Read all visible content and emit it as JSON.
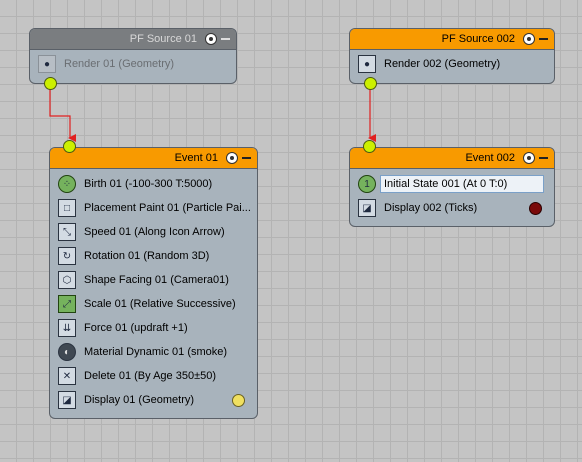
{
  "nodes": {
    "pf_source_01": {
      "title": "PF Source 01",
      "items": [
        "Render 01 (Geometry)"
      ]
    },
    "pf_source_002": {
      "title": "PF Source 002",
      "items": [
        "Render 002 (Geometry)"
      ]
    },
    "event_01": {
      "title": "Event 01",
      "items": [
        "Birth 01 (-100-300 T:5000)",
        "Placement Paint 01 (Particle Pai...",
        "Speed 01 (Along Icon Arrow)",
        "Rotation 01 (Random 3D)",
        "Shape Facing 01 (Camera01)",
        "Scale 01 (Relative Successive)",
        "Force 01 (updraft +1)",
        "Material Dynamic 01 (smoke)",
        "Delete 01 (By Age 350±50)",
        "Display 01 (Geometry)"
      ]
    },
    "event_002": {
      "title": "Event 002",
      "items": [
        "Initial State 001 (At 0 T:0)",
        "Display 002 (Ticks)"
      ]
    }
  },
  "colors": {
    "header_active": "#f89a00",
    "header_inactive": "#7a7d80",
    "port": "#ccf000",
    "wire": "#e02020",
    "display_01_swatch": "#f0e060",
    "display_002_swatch": "#7a0a0a"
  },
  "icons": {
    "birth": "birth-icon",
    "placement_paint": "placement-paint-icon",
    "speed": "speed-icon",
    "rotation": "rotation-icon",
    "shape_facing": "shape-facing-icon",
    "scale": "scale-icon",
    "force": "force-icon",
    "material_dynamic": "material-dynamic-icon",
    "delete": "delete-icon",
    "display": "display-icon",
    "initial_state": "initial-state-icon",
    "render": "teapot-icon",
    "light": "lightbulb-icon",
    "minimize": "minus-icon"
  }
}
